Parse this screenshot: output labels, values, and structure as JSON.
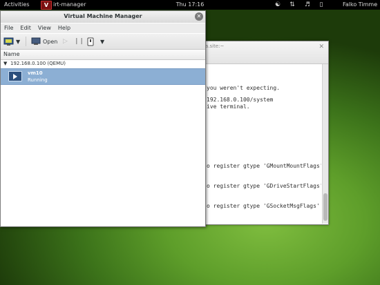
{
  "topbar": {
    "activities": "Activities",
    "app_icon": "V",
    "app_name": "irt-manager",
    "clock": "Thu 17:16",
    "user": "Falko Timme",
    "icons": [
      "accessibility-icon",
      "network-icon",
      "volume-icon",
      "battery-icon"
    ]
  },
  "terminal": {
    "title": "a.site:~",
    "lines": [
      "you weren't expecting.",
      "192.168.0.100/system",
      "ive terminal.",
      "o register gtype 'GMountMountFlags'",
      "o register gtype 'GDriveStartFlags'",
      "o register gtype 'GSocketMsgFlags'"
    ]
  },
  "vmm": {
    "title": "Virtual Machine Manager",
    "menu": [
      "File",
      "Edit",
      "View",
      "Help"
    ],
    "toolbar": {
      "open_label": "Open"
    },
    "column_header": "Name",
    "connection": "192.168.0.100 (QEMU)",
    "vm": {
      "name": "vm10",
      "status": "Running"
    }
  }
}
